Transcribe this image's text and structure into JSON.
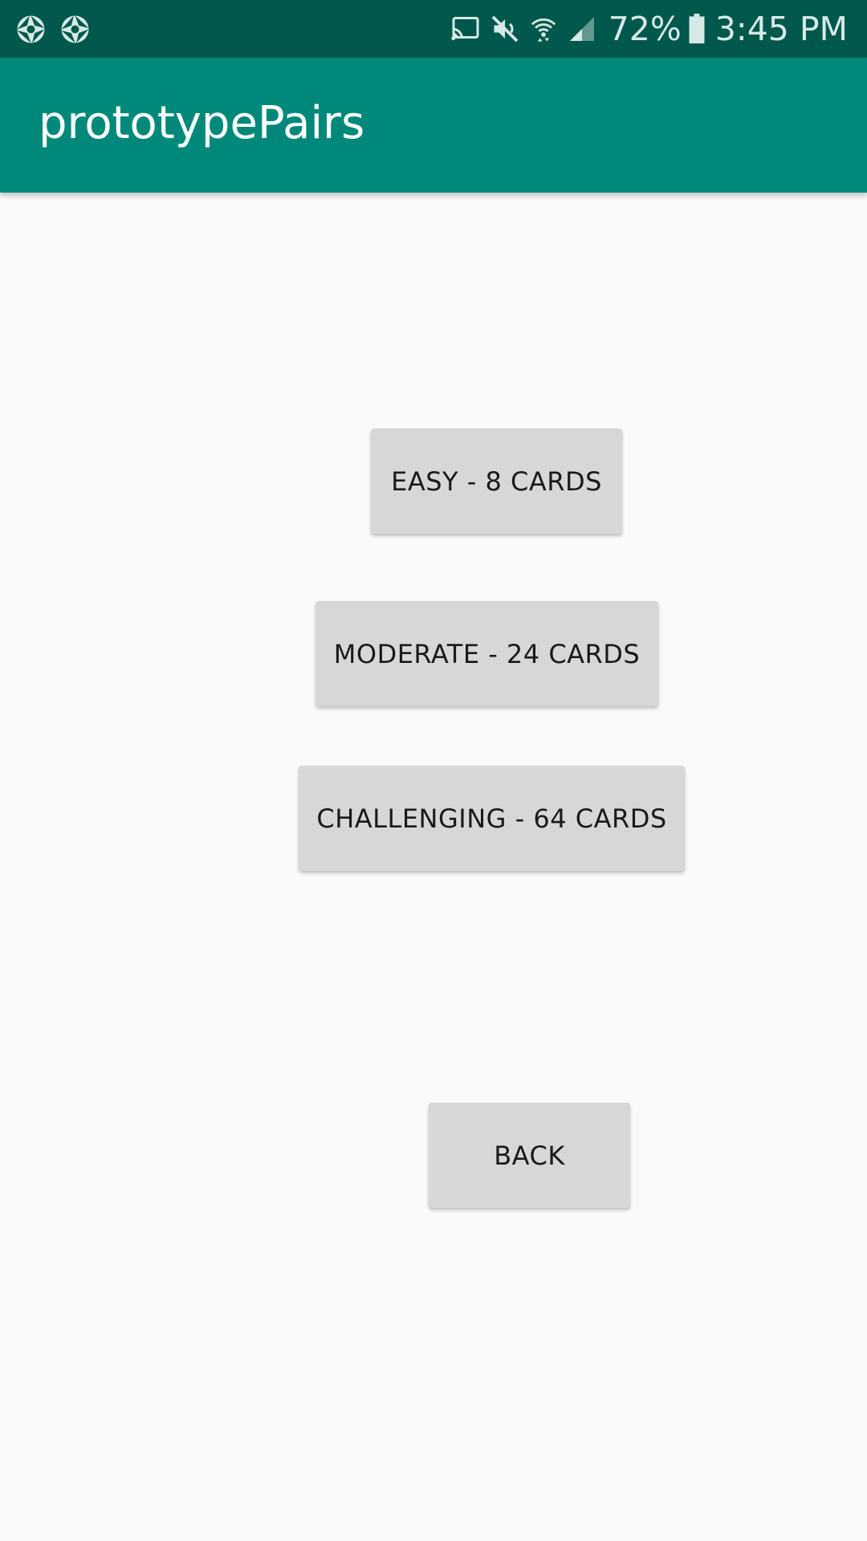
{
  "status_bar": {
    "left_icons": [
      "shutter-icon",
      "shutter-icon"
    ],
    "right_icons": [
      "cast-icon",
      "mute-icon",
      "wifi-icon",
      "signal-icon",
      "battery-icon"
    ],
    "battery_percent": "72%",
    "time": "3:45 PM",
    "background_color": "#00574b"
  },
  "app_bar": {
    "title": "prototypePairs",
    "background_color": "#00897b"
  },
  "buttons": {
    "easy": "EASY - 8 CARDS",
    "moderate": "MODERATE - 24 CARDS",
    "challenging": "CHALLENGING - 64 CARDS",
    "back": "BACK"
  }
}
